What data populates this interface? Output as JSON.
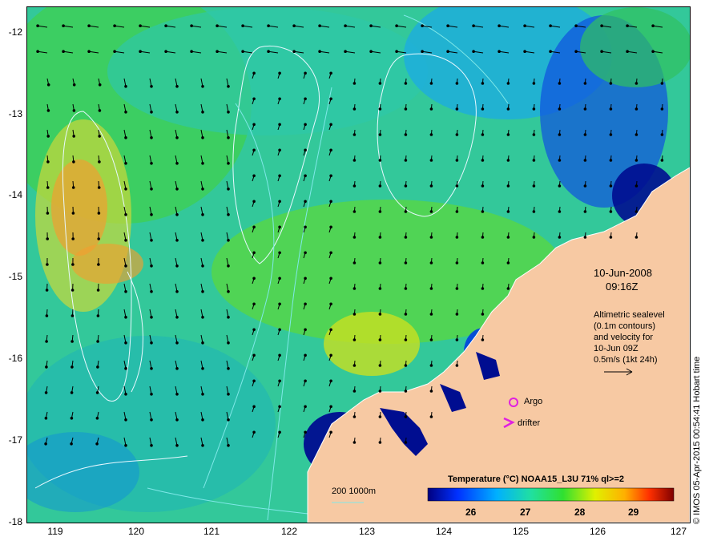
{
  "map": {
    "x_ticks": [
      "119",
      "120",
      "121",
      "122",
      "123",
      "124",
      "125",
      "126",
      "127"
    ],
    "y_ticks": [
      "-12",
      "-13",
      "-14",
      "-15",
      "-16",
      "-17",
      "-18"
    ],
    "lon_range": [
      118.6,
      127
    ],
    "lat_range": [
      -18,
      -11.7
    ],
    "date": "10-Jun-2008",
    "time": "09:16Z",
    "altimetry_lines": [
      "Altimetric sealevel",
      "(0.1m contours)",
      "and velocity for",
      "10-Jun 09Z",
      "0.5m/s (1kt 24h)"
    ],
    "argo_label": "Argo",
    "drifter_label": "drifter",
    "bathy_label": "200  1000m",
    "colorbar_title": "Temperature (°C) NOAA15_L3U 71% ql>=2",
    "colorbar_ticks": [
      "26",
      "27",
      "28",
      "29"
    ],
    "colorbar_range": [
      25.3,
      29.8
    ],
    "credit": "© IMOS 05-Apr-2015 00:54:41 Hobart time",
    "colors": {
      "land": "#f7c9a3",
      "ocean_base": "#31c59a",
      "argo": "#e020e0",
      "contour": "#e8f8ff",
      "bathy": "#7fe8e8"
    }
  }
}
